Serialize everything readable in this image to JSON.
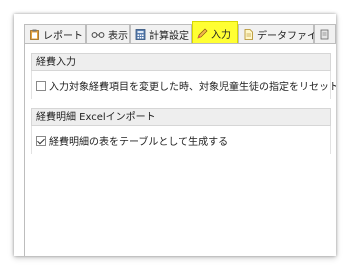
{
  "tabs": [
    {
      "label": "レポート",
      "icon": "clipboard-icon"
    },
    {
      "label": "表示",
      "icon": "glasses-icon"
    },
    {
      "label": "計算設定",
      "icon": "calculator-icon"
    },
    {
      "label": "入力",
      "icon": "pencil-icon",
      "active": true
    },
    {
      "label": "データファイル",
      "icon": "document-icon"
    },
    {
      "label": "",
      "icon": "more-icon"
    }
  ],
  "sections": [
    {
      "title": "経費入力",
      "option": {
        "label": "入力対象経費項目を変更した時、対象児童生徒の指定をリセットする",
        "checked": false
      }
    },
    {
      "title": "経費明細 Excelインポート",
      "option": {
        "label": "経費明細の表をテーブルとして生成する",
        "checked": true
      }
    }
  ],
  "colors": {
    "active_tab": "#ffff33",
    "border": "#bdbdbd",
    "group_header": "#eeeeee"
  }
}
